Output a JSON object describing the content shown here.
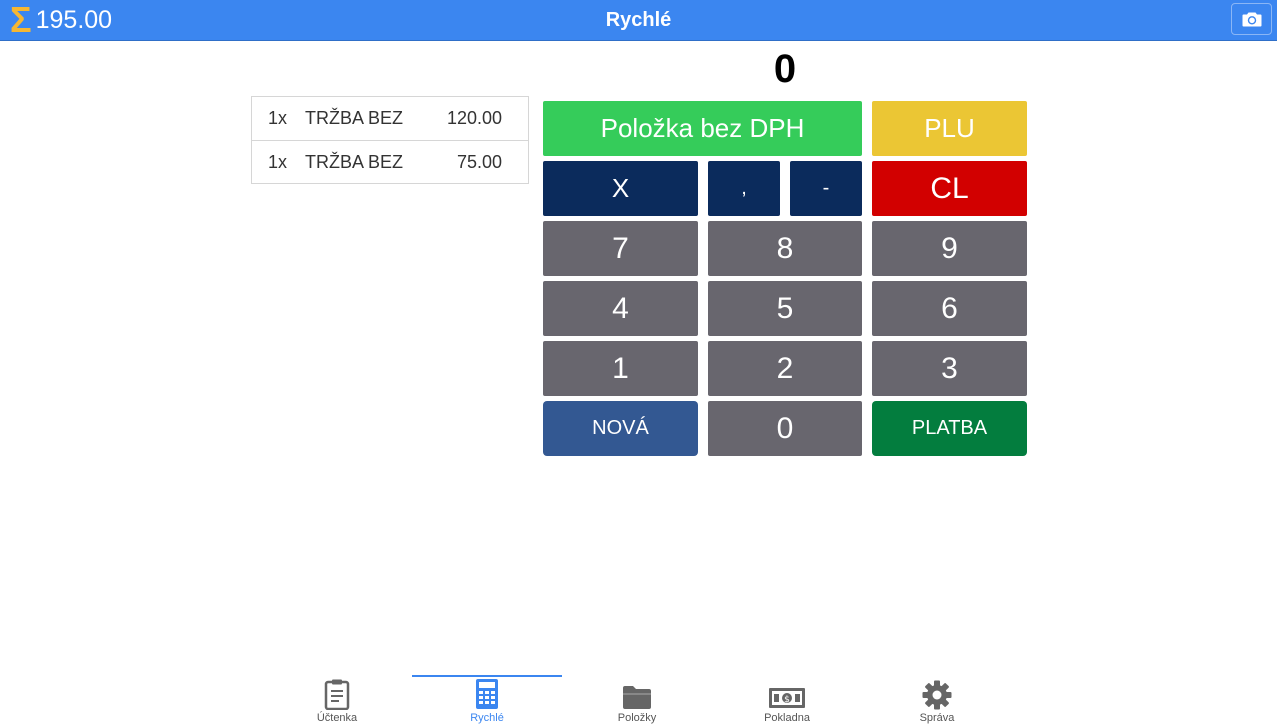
{
  "header": {
    "sum_symbol": "Σ",
    "total": "195.00",
    "title": "Rychlé",
    "camera_icon": "camera-icon"
  },
  "display": {
    "value": "0"
  },
  "receipt": {
    "items": [
      {
        "qty": "1x",
        "name": "TRŽBA BEZ",
        "price": "120.00"
      },
      {
        "qty": "1x",
        "name": "TRŽBA BEZ",
        "price": "75.00"
      }
    ]
  },
  "keypad": {
    "item_no_vat": "Položka bez DPH",
    "plu": "PLU",
    "multiply": "X",
    "comma": ",",
    "minus": "-",
    "clear": "CL",
    "d7": "7",
    "d8": "8",
    "d9": "9",
    "d4": "4",
    "d5": "5",
    "d6": "6",
    "d1": "1",
    "d2": "2",
    "d3": "3",
    "new": "NOVÁ",
    "d0": "0",
    "pay": "PLATBA"
  },
  "colors": {
    "topbar": "#3b86f0",
    "green_key": "#35cc5a",
    "yellow_key": "#ebc634",
    "red_key": "#d20000",
    "navy_key": "#0b2b5c",
    "gray_key": "#68666e",
    "blue_key": "#335892",
    "pay_key": "#037d3e"
  },
  "nav": {
    "items": [
      {
        "label": "Účtenka",
        "icon": "clipboard-icon"
      },
      {
        "label": "Rychlé",
        "icon": "calculator-icon",
        "active": true
      },
      {
        "label": "Položky",
        "icon": "folder-icon"
      },
      {
        "label": "Pokladna",
        "icon": "cash-icon"
      },
      {
        "label": "Správa",
        "icon": "gear-icon"
      }
    ]
  }
}
